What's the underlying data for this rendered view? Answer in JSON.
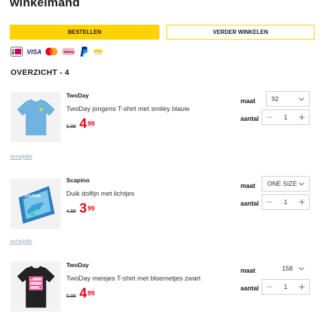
{
  "page": {
    "title": "winkelmand"
  },
  "actions": {
    "order_label": "BESTELLEN",
    "continue_label": "VERDER WINKELEN"
  },
  "payments": [
    {
      "icon": "ideal-icon",
      "color": "#cc0066"
    },
    {
      "icon": "visa-icon",
      "label": "VISA",
      "color": "#1a1f71"
    },
    {
      "icon": "mastercard-icon",
      "color": "#eb001b"
    },
    {
      "icon": "klarna-icon",
      "label": "Klarna.",
      "color": "#ffb3c7"
    },
    {
      "icon": "paypal-icon",
      "color": "#003087"
    },
    {
      "icon": "payconiq-icon",
      "color": "#ffd200"
    }
  ],
  "overview": {
    "label": "OVERZICHT - 4"
  },
  "labels": {
    "maat": "maat",
    "aantal": "aantal",
    "remove": "verwijder"
  },
  "products": [
    {
      "brand": "TwoDay",
      "name": "TwoDay jongens T-shirt met smiley blauw",
      "old_price": "5,99",
      "price_main": "4",
      "price_cents": "99",
      "size": "92",
      "quantity": "1"
    },
    {
      "brand": "Scapino",
      "name": "Duik dolfijn met lichtjes",
      "old_price": "4,99",
      "price_main": "3",
      "price_cents": "99",
      "size": "ONE SIZE",
      "quantity": "1"
    },
    {
      "brand": "TwoDay",
      "name": "TwoDay meisjes T-shirt met bloemetjes zwart",
      "old_price": "5,99",
      "price_main": "4",
      "price_cents": "99",
      "size": "158",
      "quantity": "1"
    }
  ],
  "colors": {
    "accent": "#ffd200",
    "price_red": "#e30613",
    "remove_link": "#9aa9b8"
  }
}
